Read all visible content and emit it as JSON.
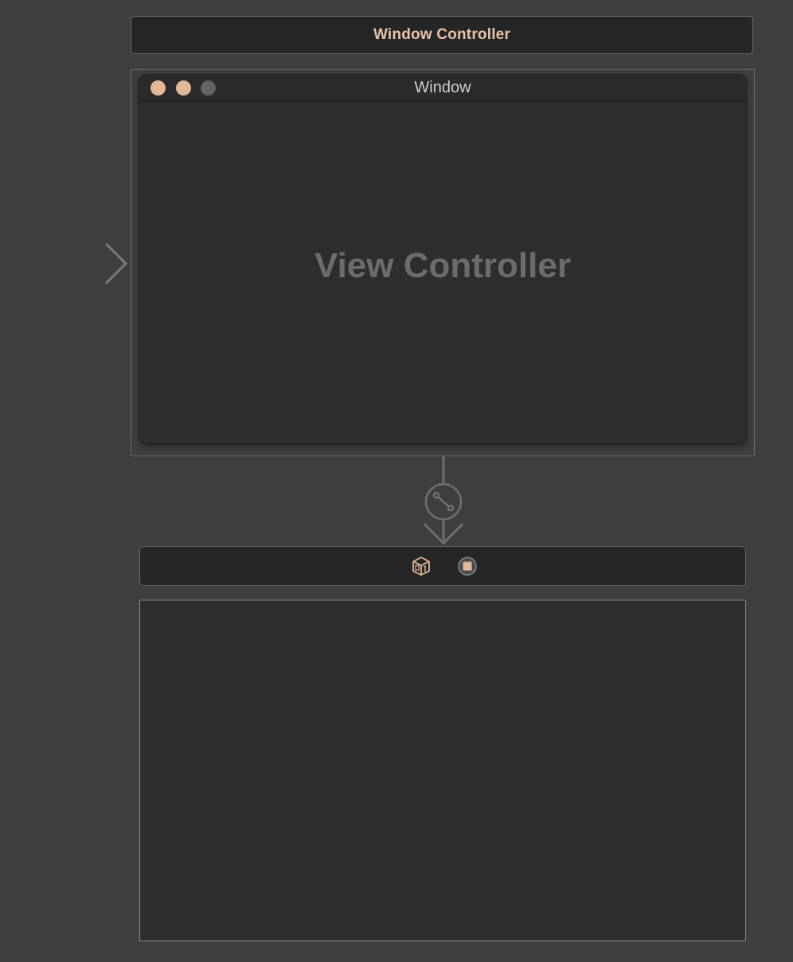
{
  "window_controller_scene": {
    "title": "Window Controller"
  },
  "window": {
    "title": "Window",
    "content_label": "View Controller"
  },
  "view_controller_scene": {
    "dock_icons": [
      "view-controller-icon",
      "first-responder-icon"
    ]
  },
  "colors": {
    "canvas": "#3f3f3f",
    "scene_header": "#262626",
    "accent": "#e2b79a",
    "window_body": "#2e2e2e",
    "placeholder_text": "#6c6c6c"
  }
}
